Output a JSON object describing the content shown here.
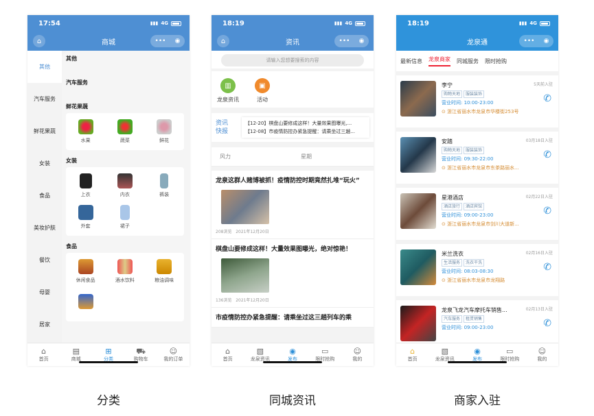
{
  "captions": [
    "分类",
    "同城资讯",
    "商家入驻"
  ],
  "phone1": {
    "time": "17:54",
    "signal": "4G",
    "title": "商城",
    "sidebar": [
      "其他",
      "汽车服务",
      "鲜花果蔬",
      "女装",
      "食品",
      "美妆护肤",
      "餐饮",
      "母婴",
      "居家"
    ],
    "sections": [
      {
        "name": "其他",
        "items": []
      },
      {
        "name": "汽车服务",
        "items": []
      },
      {
        "name": "鲜花果蔬",
        "items": [
          "水果",
          "蔬菜",
          "鲜花"
        ]
      },
      {
        "name": "女装",
        "items": [
          "上衣",
          "内衣",
          "裤装",
          "外套",
          "裙子"
        ]
      },
      {
        "name": "食品",
        "items": [
          "休闲食品",
          "酒水饮料",
          "粮油调味"
        ]
      }
    ],
    "tabs": [
      "首页",
      "商城",
      "分类",
      "购物车",
      "我的订单"
    ]
  },
  "phone2": {
    "time": "18:19",
    "signal": "4G",
    "title": "资讯",
    "search_placeholder": "请输入您想要搜索的内容",
    "icons": [
      "龙泉资讯",
      "活动"
    ],
    "news_label1": "资讯",
    "news_label2": "快报",
    "news_items": [
      "【12-20】棋盘山要修成这样！大量效果图曝光,...",
      "【12-08】市疫情防控办紧急提醒：请乘坐过三趟..."
    ],
    "columns": [
      "风力",
      "星期"
    ],
    "articles": [
      {
        "title": "龙泉这群人赌博被抓！疫情防控时期竟然扎堆“玩火”",
        "views": "208浏览",
        "date": "2021年12月20日"
      },
      {
        "title": "棋盘山要修成这样！大量效果图曝光，绝对惊艳！",
        "views": "136浏览",
        "date": "2021年12月20日"
      },
      {
        "title": "市疫情防控办紧急提醒：请乘坐过这三趟列车的乘",
        "views": "",
        "date": ""
      }
    ],
    "tabs": [
      "首页",
      "龙泉资讯",
      "发布",
      "限时抢购",
      "我的"
    ]
  },
  "phone3": {
    "time": "18:19",
    "signal": "4G",
    "title": "龙泉通",
    "top_tabs": [
      "最新信息",
      "龙泉商家",
      "同城服务",
      "限时抢购"
    ],
    "shops": [
      {
        "name": "李宁",
        "tags": [
          "购物天地",
          "服装装饰"
        ],
        "hours": "营业时间: 10:00-23:00",
        "addr": "浙江省丽水市龙泉市华楼街253号",
        "date": "5天前入驻"
      },
      {
        "name": "安踏",
        "tags": [
          "购物天地",
          "服装装饰"
        ],
        "hours": "营业时间: 09:30-22:00",
        "addr": "浙江省丽水市龙泉市东茶路丽水...",
        "date": "03月18日入驻"
      },
      {
        "name": "星港酒店",
        "tags": [
          "酒店旅行",
          "酒店宾馆"
        ],
        "hours": "营业时间: 09:00-23:00",
        "addr": "浙江省丽水市龙泉市剑川大道新...",
        "date": "02月22日入驻"
      },
      {
        "name": "米兰洗衣",
        "tags": [
          "生活服务",
          "洗衣干洗"
        ],
        "hours": "营业时间: 08:03-08:30",
        "addr": "浙江省丽水市龙泉市龙翔路",
        "date": "02月16日入驻"
      },
      {
        "name": "龙泉飞龙汽车摩托车销售...",
        "tags": [
          "汽车服务",
          "租赁销售"
        ],
        "hours": "营业时间: 09:00-23:00",
        "addr": "",
        "date": "02月13日入驻"
      }
    ],
    "tabs": [
      "首页",
      "龙泉资讯",
      "发布",
      "限时抢购",
      "我的"
    ]
  }
}
